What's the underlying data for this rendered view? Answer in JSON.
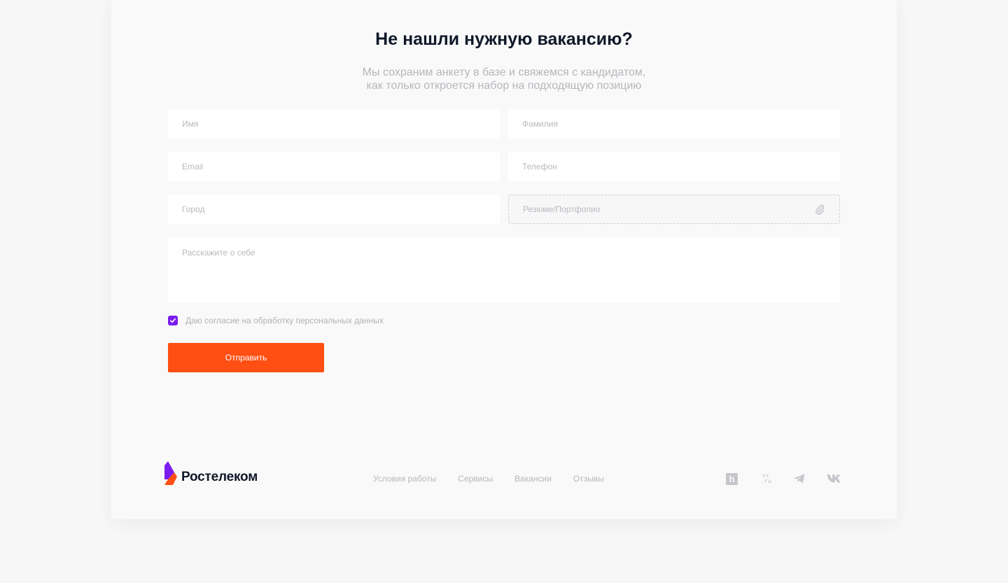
{
  "heading": {
    "title": "Не нашли нужную вакансию?",
    "subtitle_line1": "Мы сохраним анкету в базе и свяжемся с кандидатом,",
    "subtitle_line2": "как только откроется набор на подходящую позицию"
  },
  "form": {
    "first_name_placeholder": "Имя",
    "last_name_placeholder": "Фамилия",
    "email_placeholder": "Email",
    "phone_placeholder": "Телефон",
    "city_placeholder": "Город",
    "resume_label": "Резюме/Портфолио",
    "about_placeholder": "Расскажите о себе",
    "consent_label": "Даю согласие на обработку персональных данных",
    "consent_checked": true,
    "submit_label": "Отправить"
  },
  "footer": {
    "brand": "Ростелеком",
    "nav": [
      "Условия работы",
      "Сервисы",
      "Вакансии",
      "Отзывы"
    ],
    "socials": {
      "hh_glyph": "h",
      "vc_line1": "vc",
      "vc_line2": ".ru"
    },
    "social_icons": [
      "hh-icon",
      "vc-ru-icon",
      "telegram-icon",
      "vk-icon"
    ]
  },
  "colors": {
    "accent_orange": "#ff4f12",
    "accent_purple": "#7a1cf0",
    "text_dark": "#101828",
    "text_muted": "#b5b7bd"
  }
}
